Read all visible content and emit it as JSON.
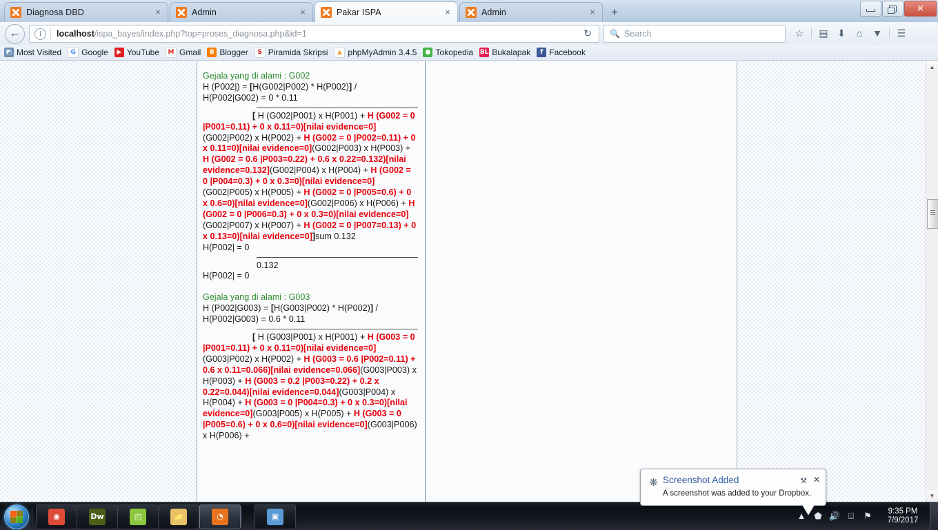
{
  "browser": {
    "tabs": [
      {
        "title": "Diagnosa DBD",
        "active": false
      },
      {
        "title": "Admin",
        "active": false
      },
      {
        "title": "Pakar ISPA",
        "active": true
      },
      {
        "title": "Admin",
        "active": false
      }
    ],
    "new_tab_label": "+",
    "tab_close_label": "×",
    "window_controls": {
      "minimize": "–",
      "maximize": "❐",
      "close": "✕"
    },
    "nav": {
      "back_label": "←",
      "url_host": "localhost",
      "url_path": "/ispa_bayes/index.php?top=proses_diagnosa.php&id=1",
      "reload_label": "↻",
      "info_label": "i",
      "search_placeholder": "Search",
      "search_icon": "🔍",
      "icons": [
        {
          "name": "bookmark-star-icon",
          "glyph": "☆"
        },
        {
          "name": "reading-list-icon",
          "glyph": "▤"
        },
        {
          "name": "downloads-icon",
          "glyph": "⬇"
        },
        {
          "name": "home-icon",
          "glyph": "⌂"
        },
        {
          "name": "pocket-icon",
          "glyph": "▼"
        },
        {
          "name": "menu-hamburger-icon",
          "glyph": "☰"
        }
      ]
    },
    "bookmarks": [
      {
        "label": "Most Visited",
        "icon": "most-visited-icon",
        "glyph": "◩",
        "color": "#6f8fb5"
      },
      {
        "label": "Google",
        "icon": "google-icon",
        "glyph": "G",
        "color": "#ffffff",
        "fg": "#4285f4"
      },
      {
        "label": "YouTube",
        "icon": "youtube-icon",
        "glyph": "▶",
        "color": "#e02020"
      },
      {
        "label": "Gmail",
        "icon": "gmail-icon",
        "glyph": "M",
        "color": "#ffffff",
        "fg": "#d93025"
      },
      {
        "label": "Blogger",
        "icon": "blogger-icon",
        "glyph": "B",
        "color": "#f57d00"
      },
      {
        "label": "Piramida Skripsi",
        "icon": "piramida-skripsi-icon",
        "glyph": "S",
        "color": "#ffffff",
        "fg": "#d01a1a"
      },
      {
        "label": "phpMyAdmin 3.4.5",
        "icon": "phpmyadmin-icon",
        "glyph": "▲",
        "color": "#ffffff",
        "fg": "#e8a33d"
      },
      {
        "label": "Tokopedia",
        "icon": "tokopedia-icon",
        "glyph": "●",
        "color": "#42b549"
      },
      {
        "label": "Bukalapak",
        "icon": "bukalapak-icon",
        "glyph": "BL",
        "color": "#e31e52"
      },
      {
        "label": "Facebook",
        "icon": "facebook-icon",
        "glyph": "f",
        "color": "#3b5998"
      }
    ]
  },
  "page": {
    "blocks": [
      {
        "heading": "Gejala yang di alami : G002",
        "formula_lines": [
          [
            {
              "t": "H (P002|) = ",
              "s": "n"
            },
            {
              "t": "[",
              "s": "b"
            },
            {
              "t": "H(G002|P002) * H(P002)",
              "s": "n"
            },
            {
              "t": "]",
              "s": "b"
            },
            {
              "t": " /",
              "s": "n"
            }
          ],
          [
            {
              "t": "H(P002|G002) = 0 * 0.11",
              "s": "n"
            }
          ]
        ],
        "rule": true,
        "expansion": [
          {
            "t": "[",
            "s": "b",
            "indent": true
          },
          {
            "t": " H (G002|P001) x H(P001) + ",
            "s": "n"
          },
          {
            "t": "H (G002 = 0 |P001=0.11) + ",
            "s": "r"
          },
          {
            "t": "0 x 0.11=0)[nilai evidence=0]",
            "s": "r"
          },
          {
            "t": "(G002|P002) x H(P002) + ",
            "s": "n"
          },
          {
            "t": "H (G002 = 0 |P002=0.11) + ",
            "s": "r"
          },
          {
            "t": "0 x 0.11=0)[nilai evidence=0]",
            "s": "r"
          },
          {
            "t": "(G002|P003) x H(P003) + ",
            "s": "n"
          },
          {
            "t": "H (G002 = 0.6 |P003=0.22) + ",
            "s": "r"
          },
          {
            "t": "0.6 x 0.22=0.132)[nilai evidence=0.132]",
            "s": "r"
          },
          {
            "t": "(G002|P004) x H(P004) + ",
            "s": "n"
          },
          {
            "t": "H (G002 = 0 |P004=0.3) + ",
            "s": "r"
          },
          {
            "t": "0 x 0.3=0)[nilai evidence=0]",
            "s": "r"
          },
          {
            "t": "(G002|P005) x H(P005) + ",
            "s": "n"
          },
          {
            "t": "H (G002 = 0 |P005=0.6) + ",
            "s": "r"
          },
          {
            "t": "0 x 0.6=0)[nilai evidence=0]",
            "s": "r"
          },
          {
            "t": "(G002|P006) x H(P006) + ",
            "s": "n"
          },
          {
            "t": "H (G002 = 0 |P006=0.3) + ",
            "s": "r"
          },
          {
            "t": "0 x 0.3=0)[nilai evidence=0]",
            "s": "r"
          },
          {
            "t": "(G002|P007) x H(P007) + ",
            "s": "n"
          },
          {
            "t": "H (G002 = 0 |P007=0.13) + ",
            "s": "r"
          },
          {
            "t": "0 x 0.13=0)[nilai evidence=0]",
            "s": "r"
          },
          {
            "t": "]",
            "s": "b"
          },
          {
            "t": "sum 0.132",
            "s": "n"
          }
        ],
        "result_pre": "H(P002| = 0",
        "rule2": true,
        "denominator": "0.132",
        "result_post": "H(P002| = 0"
      },
      {
        "heading": "Gejala yang di alami : G003",
        "formula_lines": [
          [
            {
              "t": "H (P002|G003) = ",
              "s": "n"
            },
            {
              "t": "[",
              "s": "b"
            },
            {
              "t": "H(G003|P002) * H(P002)",
              "s": "n"
            },
            {
              "t": "]",
              "s": "b"
            },
            {
              "t": " /",
              "s": "n"
            }
          ],
          [
            {
              "t": "H(P002|G003) = 0.6 * 0.11",
              "s": "n"
            }
          ]
        ],
        "rule": true,
        "expansion": [
          {
            "t": "[",
            "s": "b",
            "indent": true
          },
          {
            "t": " H (G003|P001) x H(P001) + ",
            "s": "n"
          },
          {
            "t": "H (G003 = 0 |P001=0.11) + ",
            "s": "r"
          },
          {
            "t": "0 x 0.11=0)[nilai evidence=0]",
            "s": "r"
          },
          {
            "t": "(G003|P002) x H(P002) + ",
            "s": "n"
          },
          {
            "t": "H (G003 = 0.6 |P002=0.11) + ",
            "s": "r"
          },
          {
            "t": "0.6 x 0.11=0.066)[nilai evidence=0.066]",
            "s": "r"
          },
          {
            "t": "(G003|P003) x H(P003) + ",
            "s": "n"
          },
          {
            "t": "H (G003 = 0.2 |P003=0.22) + ",
            "s": "r"
          },
          {
            "t": "0.2 x 0.22=0.044)[nilai evidence=0.044]",
            "s": "r"
          },
          {
            "t": "(G003|P004) x H(P004) + ",
            "s": "n"
          },
          {
            "t": "H (G003 = 0 |P004=0.3) + ",
            "s": "r"
          },
          {
            "t": "0 x 0.3=0)[nilai evidence=0]",
            "s": "r"
          },
          {
            "t": "(G003|P005) x H(P005) + ",
            "s": "n"
          },
          {
            "t": "H (G003 = 0 |P005=0.6) + ",
            "s": "r"
          },
          {
            "t": "0 x 0.6=0)[nilai evidence=0]",
            "s": "r"
          },
          {
            "t": "(G003|P006) x H(P006) + ",
            "s": "n"
          }
        ]
      }
    ]
  },
  "notification": {
    "title": "Screenshot Added",
    "body": "A screenshot was added to your Dropbox.",
    "gear_glyph": "⚒",
    "close_glyph": "✕",
    "icon": "dropbox-icon"
  },
  "taskbar": {
    "start_label": "Start",
    "buttons": [
      {
        "name": "taskbar-chrome",
        "glyph": "◉",
        "color": "#dd4b39",
        "active": false
      },
      {
        "name": "taskbar-dreamweaver",
        "glyph": "Dw",
        "color": "#4b5f16",
        "active": false
      },
      {
        "name": "taskbar-gallery",
        "glyph": "◰",
        "color": "#8cc63f",
        "active": false
      },
      {
        "name": "taskbar-explorer",
        "glyph": "📁",
        "color": "#e8c168",
        "active": false
      },
      {
        "name": "taskbar-firefox",
        "glyph": "◔",
        "color": "#e8731c",
        "active": true
      },
      {
        "name": "taskbar-picture-viewer",
        "glyph": "▣",
        "color": "#5b9bd5",
        "active": false
      }
    ],
    "tray": [
      {
        "name": "tray-show-hidden-icon",
        "glyph": "▲"
      },
      {
        "name": "tray-dropbox-icon",
        "glyph": "⬟"
      },
      {
        "name": "tray-volume-icon",
        "glyph": "🔊"
      },
      {
        "name": "tray-network-icon",
        "glyph": "⌸"
      },
      {
        "name": "tray-action-center-icon",
        "glyph": "⚑"
      }
    ],
    "clock_time": "9:35 PM",
    "clock_date": "7/9/2017"
  }
}
